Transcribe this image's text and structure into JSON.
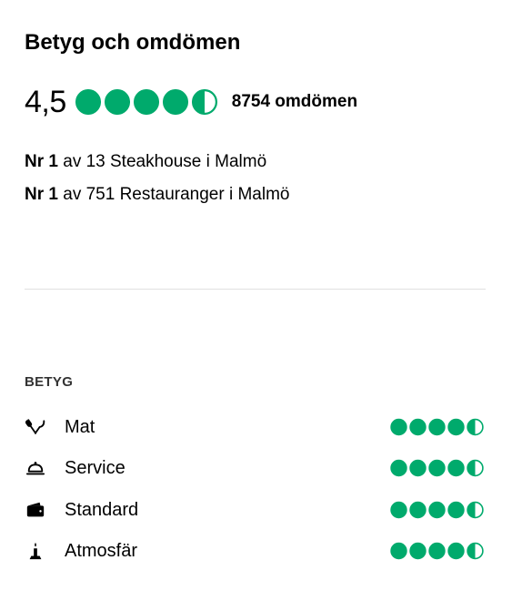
{
  "title": "Betyg och omdömen",
  "overall": {
    "score": "4,5",
    "bubble_rating": 4.5,
    "review_count": "8754 omdömen"
  },
  "rankings": [
    {
      "rank": "Nr 1",
      "text": "av 13 Steakhouse i Malmö"
    },
    {
      "rank": "Nr 1",
      "text": "av 751 Restauranger i Malmö"
    }
  ],
  "subratings": {
    "heading": "BETYG",
    "items": [
      {
        "label": "Mat",
        "icon": "utensils-icon",
        "rating": 4.5
      },
      {
        "label": "Service",
        "icon": "service-bell-icon",
        "rating": 4.5
      },
      {
        "label": "Standard",
        "icon": "wallet-icon",
        "rating": 4.5
      },
      {
        "label": "Atmosfär",
        "icon": "candle-icon",
        "rating": 4.5
      }
    ]
  },
  "colors": {
    "bubble_fill": "#00aa6c",
    "text": "#000000",
    "divider": "#e0e0e0"
  }
}
